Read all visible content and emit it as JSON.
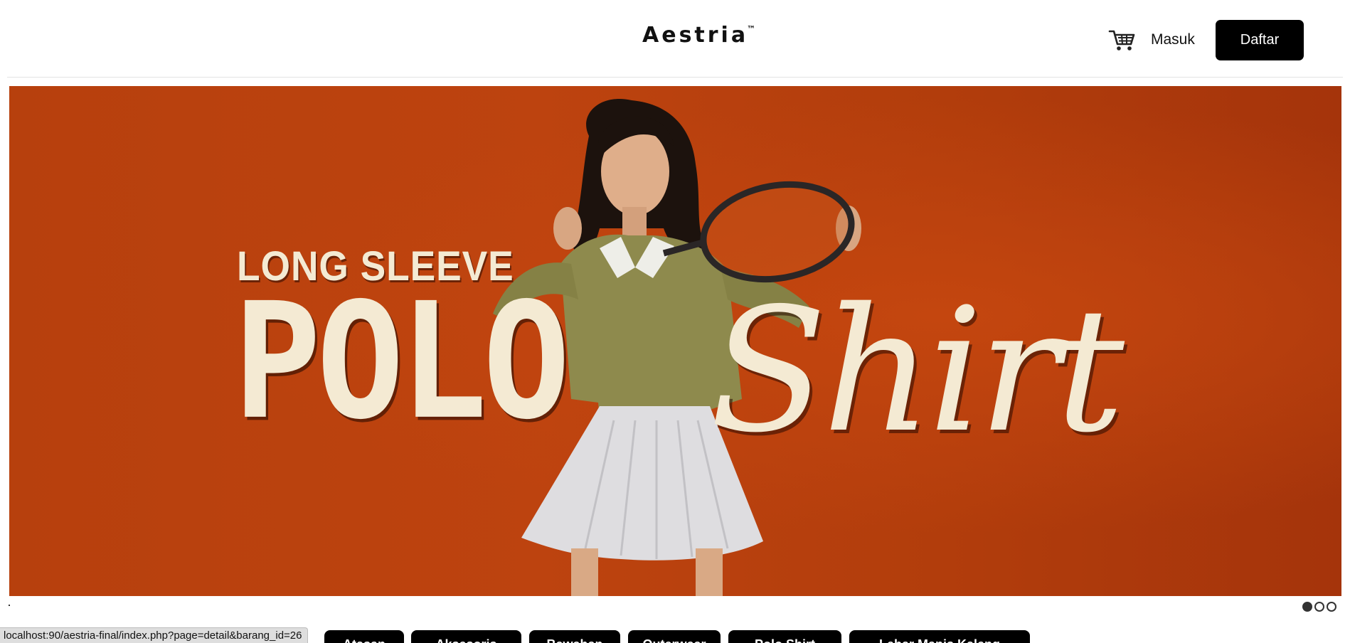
{
  "header": {
    "brand": "Aestria",
    "brand_mark": "™",
    "login_label": "Masuk",
    "register_label": "Daftar",
    "cart_icon": "cart-icon"
  },
  "banner": {
    "headline_small": "LONG SLEEVE",
    "headline_polo": "POLO",
    "headline_shirt": "Shirt",
    "colors": {
      "background": "#b7400d",
      "text": "#f4ead3"
    }
  },
  "carousel": {
    "slides": 3,
    "active_index": 0
  },
  "status_bar": {
    "url": "localhost:90/aestria-final/index.php?page=detail&barang_id=26"
  },
  "categories": [
    {
      "label": "Atasan"
    },
    {
      "label": "Aksesoris"
    },
    {
      "label": "Bawahan"
    },
    {
      "label": "Outerwear"
    },
    {
      "label": "Polo Shirt"
    },
    {
      "label": "Lebar Manis Kaleng"
    }
  ]
}
